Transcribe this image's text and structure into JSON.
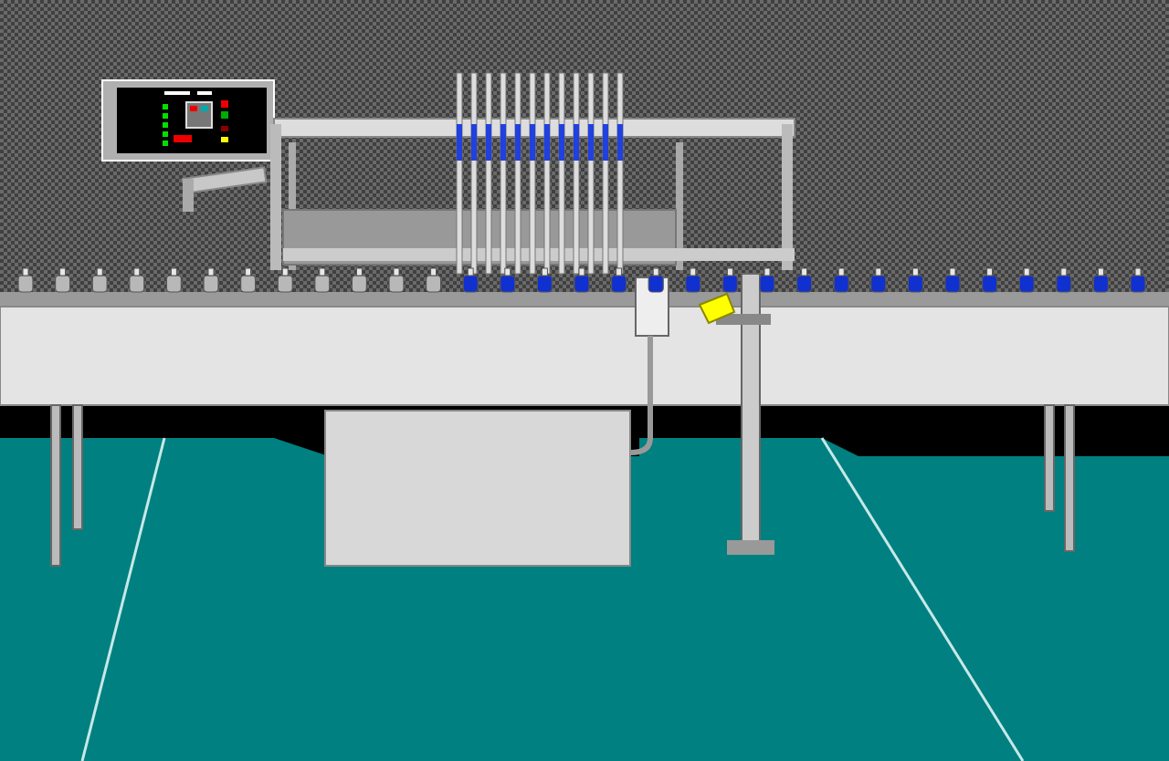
{
  "bottles": [
    {
      "filled": false
    },
    {
      "filled": false
    },
    {
      "filled": false
    },
    {
      "filled": false
    },
    {
      "filled": false
    },
    {
      "filled": false
    },
    {
      "filled": false
    },
    {
      "filled": false
    },
    {
      "filled": false
    },
    {
      "filled": false
    },
    {
      "filled": false
    },
    {
      "filled": false
    },
    {
      "filled": true
    },
    {
      "filled": true
    },
    {
      "filled": true
    },
    {
      "filled": true
    },
    {
      "filled": true
    },
    {
      "filled": true
    },
    {
      "filled": true
    },
    {
      "filled": true
    },
    {
      "filled": true
    },
    {
      "filled": true
    },
    {
      "filled": true
    },
    {
      "filled": true
    },
    {
      "filled": true
    },
    {
      "filled": true
    },
    {
      "filled": true
    },
    {
      "filled": true
    },
    {
      "filled": true
    },
    {
      "filled": true
    },
    {
      "filled": true
    }
  ]
}
